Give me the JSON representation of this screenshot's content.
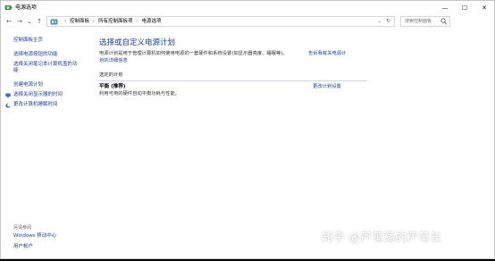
{
  "window": {
    "title": "电源选项"
  },
  "titlebar": {
    "minimize_glyph": "—",
    "maximize_glyph": "☐",
    "close_glyph": "✕"
  },
  "nav": {
    "back_glyph": "←",
    "forward_glyph": "→",
    "dropdown_glyph": "⌄",
    "up_glyph": "↑",
    "breadcrumbs": [
      "控制面板",
      "所有控制面板项",
      "电源选项"
    ],
    "crumb_separator": "›",
    "address_dropdown_glyph": "⌄",
    "refresh_glyph": "↻",
    "search_placeholder": "搜索控制面板"
  },
  "sidebar": {
    "home": "控制面板主页",
    "items": [
      "选择电源按钮的功能",
      "选择关闭笔记本计算机盖的功",
      "能",
      "创建电源计划",
      "选择关闭显示器的时间",
      "更改计算机睡眠时间"
    ],
    "see_also_label": "另请参阅",
    "see_also_items": [
      "Windows 移动中心",
      "用户帐户"
    ]
  },
  "main": {
    "title": "选择或自定义电源计划",
    "description": "电源计划是用于管理计算机如何使用电源的一套硬件和系统设置(如显示器亮度、睡眠等)。",
    "learn_more": "告诉我有关电源计",
    "learn_more_2": "划的详细信息",
    "section_label": "选定的计划",
    "plan_name": "平衡 (推荐)",
    "plan_description": "利用可用的硬件自动平衡功耗与性能。",
    "plan_settings_link": "更改计划设置"
  },
  "watermark": "知乎 @芦苇荡的芦苇长",
  "colors": {
    "link": "#1a3e9f",
    "title": "#1c3fa4",
    "divider": "#cfd8e6"
  }
}
